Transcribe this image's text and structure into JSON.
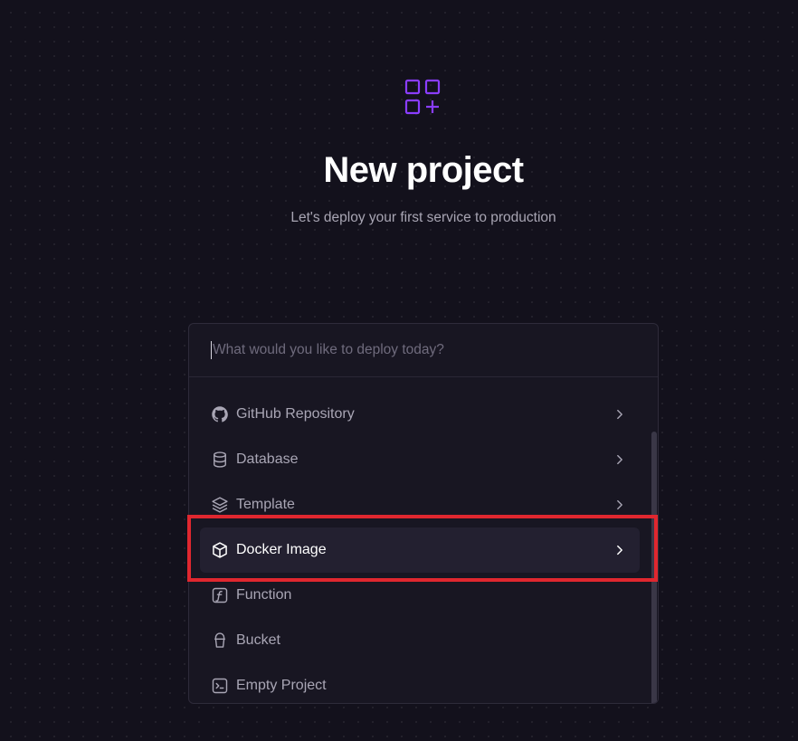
{
  "header": {
    "title": "New project",
    "subtitle": "Let's deploy your first service to production",
    "logo_icon": "grid-plus-icon",
    "accent_color": "#8a3dff"
  },
  "search": {
    "placeholder": "What would you like to deploy today?",
    "value": ""
  },
  "options": [
    {
      "label": "GitHub Repository",
      "icon": "github-icon",
      "has_submenu": true
    },
    {
      "label": "Database",
      "icon": "database-icon",
      "has_submenu": true
    },
    {
      "label": "Template",
      "icon": "layers-icon",
      "has_submenu": true
    },
    {
      "label": "Docker Image",
      "icon": "cube-icon",
      "has_submenu": true,
      "selected": true
    },
    {
      "label": "Function",
      "icon": "function-icon",
      "has_submenu": false
    },
    {
      "label": "Bucket",
      "icon": "bucket-icon",
      "has_submenu": false
    },
    {
      "label": "Empty Project",
      "icon": "terminal-icon",
      "has_submenu": false
    }
  ],
  "colors": {
    "background": "#13111c",
    "panel": "#181622",
    "selected_row": "#232030",
    "highlight_outline": "#e0272f"
  }
}
